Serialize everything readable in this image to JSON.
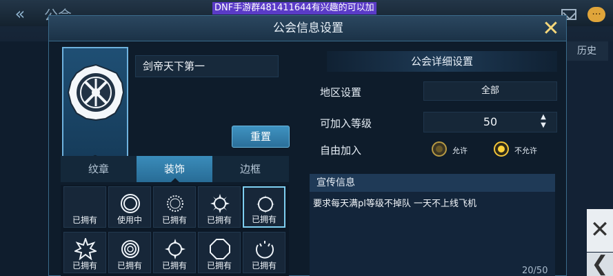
{
  "topbar": {
    "back_icon": "back-arrow-icon",
    "title": "公会",
    "banner": "DNF手游群481411644有兴趣的可以加",
    "mail_icon": "mail-icon",
    "chat_icon": "chat-icon",
    "chat_glyph": "···"
  },
  "side": {
    "history_tab": "历史",
    "close_icon": "close-x-icon",
    "close_glyph": "✕",
    "back_icon": "chevron-left-icon",
    "back_glyph": "❮"
  },
  "dialog": {
    "title": "公会信息设置",
    "close_glyph": "✕"
  },
  "emblem": {
    "guild_name": "剑帝天下第一",
    "reset_label": "重置"
  },
  "tabs": [
    {
      "label": "纹章",
      "active": false
    },
    {
      "label": "装饰",
      "active": true
    },
    {
      "label": "边框",
      "active": false
    }
  ],
  "decorations": [
    {
      "label": "已拥有",
      "icon": "empty-icon",
      "selected": false
    },
    {
      "label": "使用中",
      "icon": "ring-double-icon",
      "selected": false
    },
    {
      "label": "已拥有",
      "icon": "ring-dotted-icon",
      "selected": false
    },
    {
      "label": "已拥有",
      "icon": "sun-spiked-icon",
      "selected": false
    },
    {
      "label": "已拥有",
      "icon": "ring-thorns-icon",
      "selected": true
    },
    {
      "label": "已拥有",
      "icon": "star-burst-icon",
      "selected": false
    },
    {
      "label": "已拥有",
      "icon": "ring-concentric-icon",
      "selected": false
    },
    {
      "label": "已拥有",
      "icon": "sun-ray-icon",
      "selected": false
    },
    {
      "label": "已拥有",
      "icon": "octagon-icon",
      "selected": false
    },
    {
      "label": "已拥有",
      "icon": "ring-open-icon",
      "selected": false
    }
  ],
  "details": {
    "heading": "公会详细设置",
    "region_label": "地区设置",
    "region_value": "全部",
    "level_label": "可加入等级",
    "level_value": "50",
    "free_join_label": "自由加入",
    "allow_label": "允许",
    "deny_label": "不允许",
    "free_join_selected": "不允许"
  },
  "promo": {
    "heading": "宣传信息",
    "text": "要求每天满pl等级不掉队 一天不上线飞机",
    "count": "20/50"
  },
  "colors": {
    "accent": "#3a8cba",
    "gold": "#f2c53a",
    "border": "#3b6c8c"
  }
}
